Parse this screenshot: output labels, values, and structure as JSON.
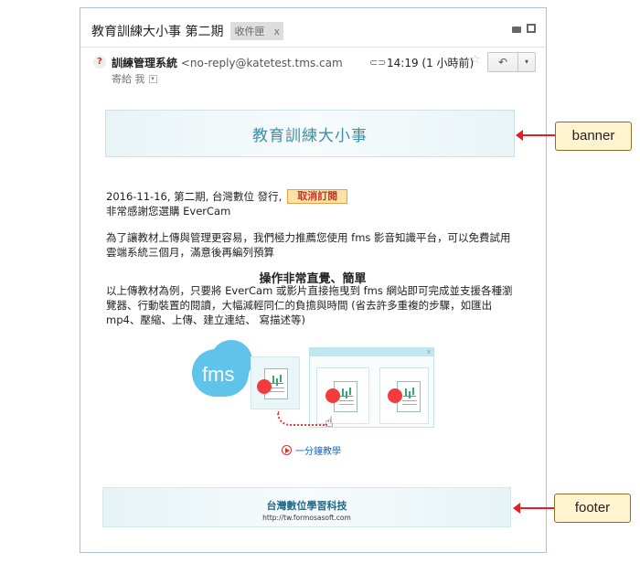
{
  "email": {
    "subject": "教育訓練大小事 第二期",
    "label_tag": "收件匣",
    "label_remove": "x",
    "sender_name": "訓練管理系統",
    "sender_email": "<no-reply@katetest.tms.camder",
    "recipient_line": "寄給 我",
    "time": "14:19 (1 小時前)",
    "icons": {
      "print": "print-icon",
      "new_window": "new-window-icon",
      "sender_avatar": "question-icon",
      "attachment": "paperclip-icon",
      "star": "star-icon",
      "reply": "reply-icon",
      "more": "chevron-down-icon"
    },
    "glyphs": {
      "avatar": "?",
      "clip": "⊂⊃",
      "star": "☆",
      "reply": "↶",
      "more": "▾",
      "caret": "▾"
    }
  },
  "content": {
    "banner_title": "教育訓練大小事",
    "issue_line": "2016-11-16, 第二期, 台灣數位 發行,",
    "unsubscribe_label": "取消訂閱",
    "thanks_line": "非常感謝您選購 EverCam",
    "para1": "為了讓教材上傳與管理更容易，我們極力推薦您使用 fms 影音知識平台，可以免費試用雲端系統三個月，滿意後再編列預算",
    "heading": "操作非常直覺、簡單",
    "para2": "以上傳教材為例，只要將 EverCam 或影片直接拖曳到 fms 網站即可完成並支援各種瀏覽器、行動裝置的閱讀，大幅減輕同仁的負擔與時間 (省去許多重複的步驟，如匯出 mp4、壓縮、上傳、建立連結、 寫描述等)",
    "illustration_logo": "fms",
    "window_close": "x",
    "video_link": "一分鐘教學"
  },
  "footer": {
    "company": "台灣數位學習科技",
    "url": "http://tw.formosasoft.com"
  },
  "annotations": {
    "banner_label": "banner",
    "footer_label": "footer",
    "color": "#e31e24"
  }
}
